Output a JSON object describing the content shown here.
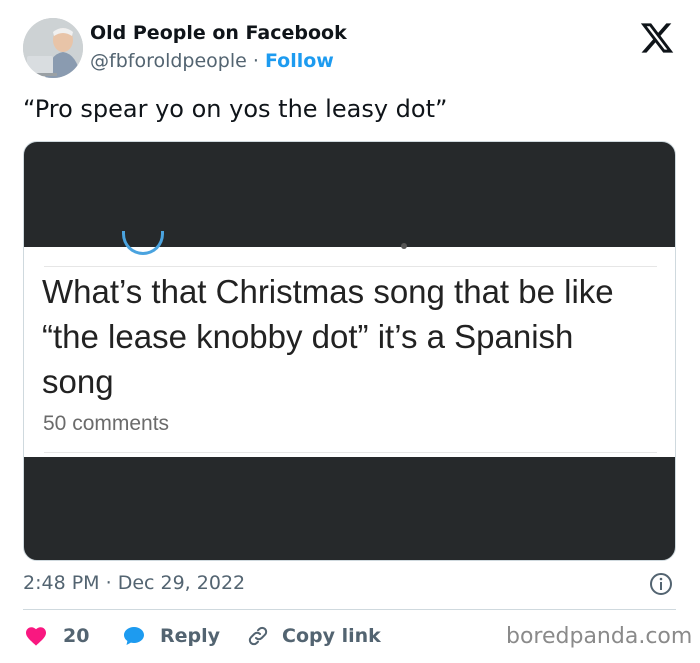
{
  "author": {
    "name": "Old People on Facebook",
    "handle": "@fbforoldpeople",
    "separator": "·",
    "follow_label": "Follow",
    "avatar_icon": "avatar-photo"
  },
  "platform_icon": "x-logo-icon",
  "tweet_text": "“Pro spear yo on yos the leasy dot”",
  "embedded_post": {
    "title": "What’s that Christmas song that be like\n“the lease knobby dot” it’s a Spanish\nsong",
    "comments": "50 comments"
  },
  "timestamp": {
    "time": "2:48 PM",
    "separator": "·",
    "date": "Dec 29, 2022"
  },
  "actions": {
    "like_count": "20",
    "reply_label": "Reply",
    "copy_link_label": "Copy link"
  },
  "watermark": "boredpanda.com",
  "colors": {
    "accent": "#1d9bf0",
    "like": "#f91880",
    "text": "#0f1419",
    "muted": "#536471"
  }
}
